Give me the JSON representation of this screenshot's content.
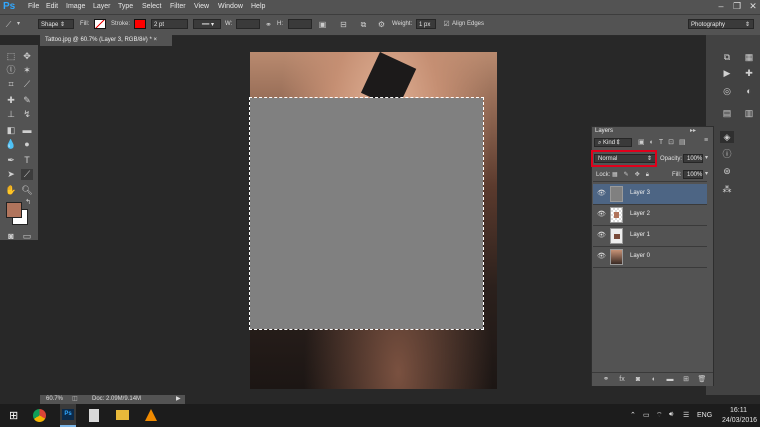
{
  "app": {
    "logo": "Ps"
  },
  "menu": [
    "File",
    "Edit",
    "Image",
    "Layer",
    "Type",
    "Select",
    "Filter",
    "View",
    "Window",
    "Help"
  ],
  "window_buttons": [
    "–",
    "❐",
    "✕"
  ],
  "options": {
    "mode": "Shape",
    "fill_label": "Fill:",
    "stroke_label": "Stroke:",
    "stroke_width": "2 pt",
    "w_label": "W:",
    "h_label": "H:",
    "go_label": "GO",
    "weight_label": "Weight:",
    "weight_value": "1 px",
    "align_edges": "Align Edges",
    "workspace": "Photography",
    "stroke_color": "#ff0000"
  },
  "document": {
    "tab": "Tattoo.jpg @ 60.7% (Layer 3, RGB/8#) *",
    "zoom": "60.7%",
    "doc_info": "Doc: 2.09M/9.14M"
  },
  "colors": {
    "foreground": "#b0745c",
    "background": "#ffffff"
  },
  "layers_panel": {
    "tab": "Layers",
    "kind": "Kind",
    "blend_mode": "Normal",
    "opacity_label": "Opacity:",
    "opacity": "100%",
    "lock_label": "Lock:",
    "fill_label": "Fill:",
    "fill": "100%",
    "layers": [
      {
        "name": "Layer 3",
        "selected": true
      },
      {
        "name": "Layer 2",
        "selected": false
      },
      {
        "name": "Layer 1",
        "selected": false
      },
      {
        "name": "Layer 0",
        "selected": false
      }
    ]
  },
  "taskbar": {
    "lang": "ENG",
    "time": "16:11",
    "date": "24/03/2016"
  }
}
